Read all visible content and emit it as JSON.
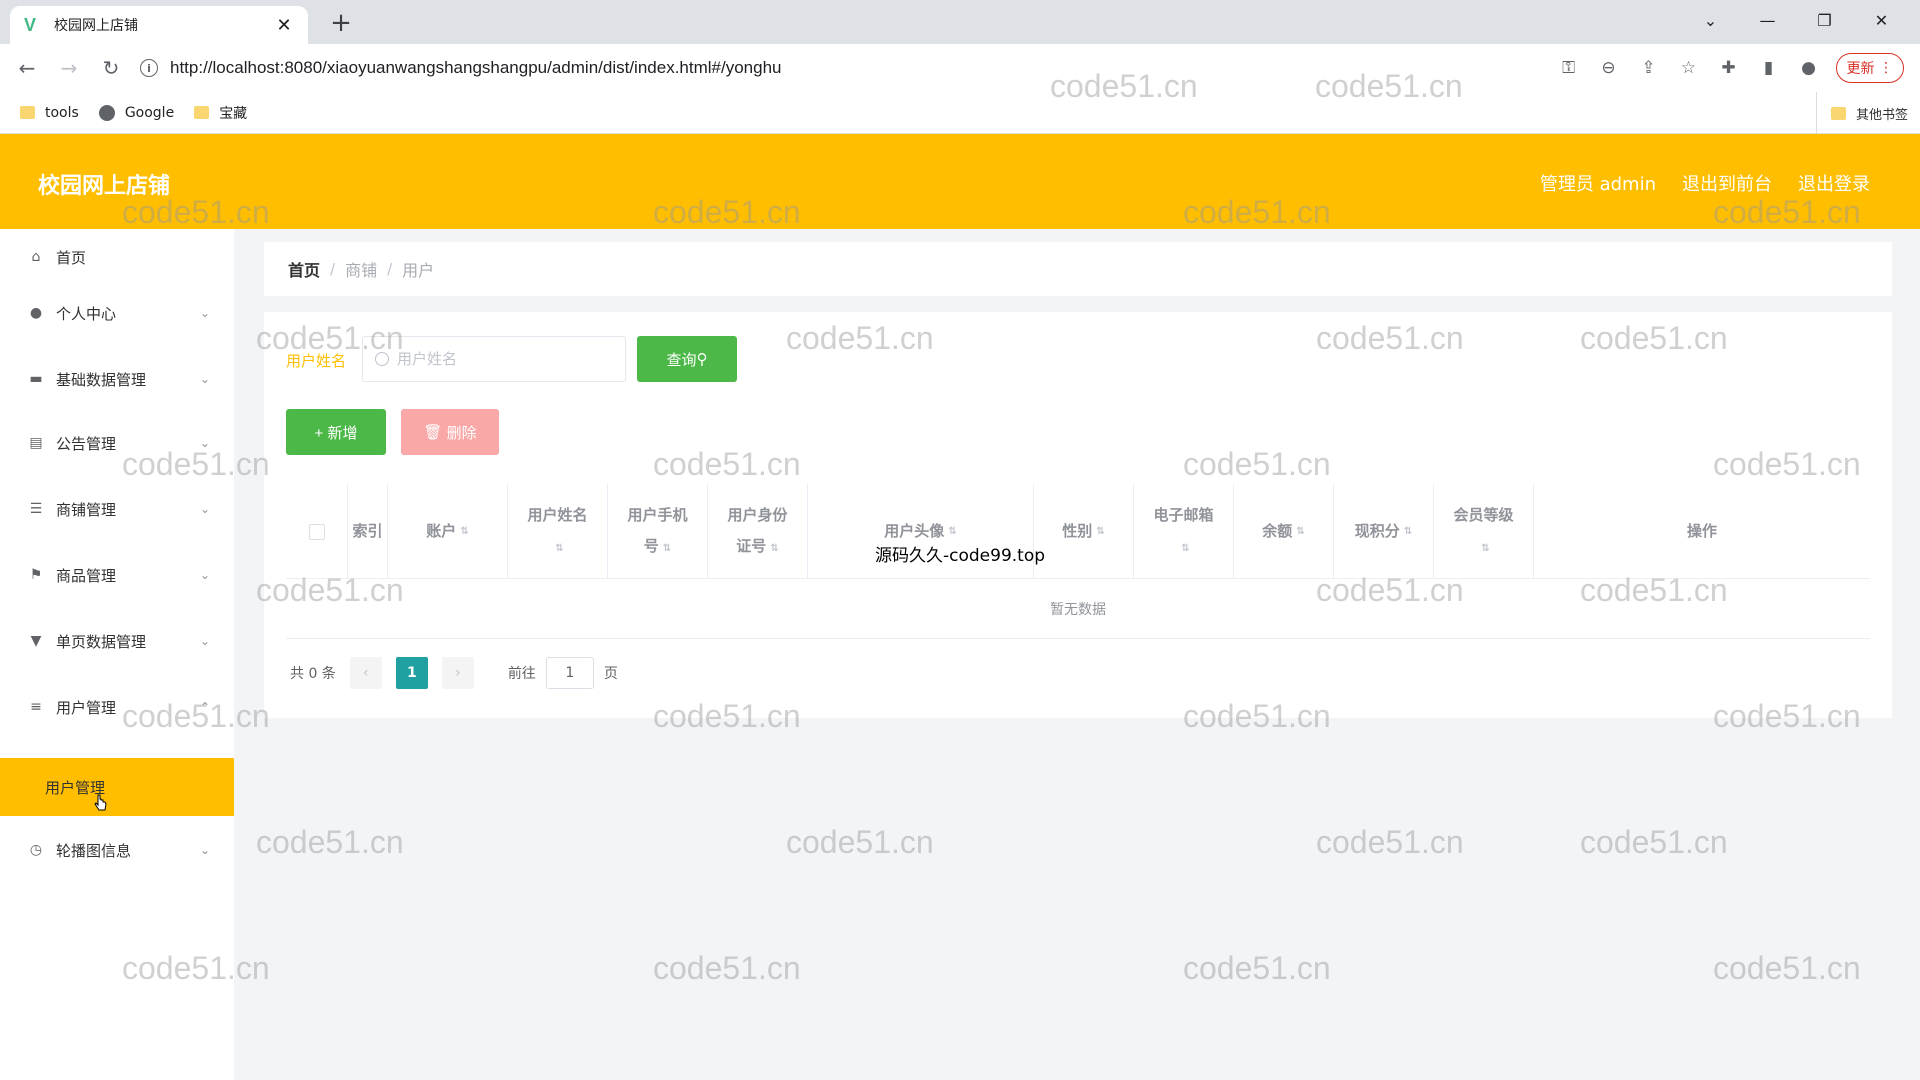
{
  "browser": {
    "tab_title": "校园网上店铺",
    "tab_close": "✕",
    "new_tab": "+",
    "url": "http://localhost:8080/xiaoyuanwangshangshangpu/admin/dist/index.html#/yonghu",
    "update_label": "更新",
    "bookmarks": [
      {
        "label": "tools",
        "icon": "folder-icon"
      },
      {
        "label": "Google",
        "icon": "globe-icon"
      },
      {
        "label": "宝藏",
        "icon": "folder-icon"
      }
    ],
    "other_bookmarks": "其他书签"
  },
  "header": {
    "brand": "校园网上店铺",
    "admin_label": "管理员 admin",
    "back_to_front": "退出到前台",
    "logout": "退出登录"
  },
  "sidebar": {
    "items": [
      {
        "label": "首页",
        "icon": "home-icon",
        "chevron": false
      },
      {
        "label": "个人中心",
        "icon": "user-icon",
        "chevron": true
      },
      {
        "label": "基础数据管理",
        "icon": "briefcase-icon",
        "chevron": true
      },
      {
        "label": "公告管理",
        "icon": "clipboard-icon",
        "chevron": true
      },
      {
        "label": "商铺管理",
        "icon": "sliders-icon",
        "chevron": true
      },
      {
        "label": "商品管理",
        "icon": "flag-icon",
        "chevron": true
      },
      {
        "label": "单页数据管理",
        "icon": "pin-icon",
        "chevron": true
      },
      {
        "label": "用户管理",
        "icon": "menu-icon",
        "chevron": true
      },
      {
        "label": "轮播图信息",
        "icon": "clock-icon",
        "chevron": true
      }
    ],
    "active_sub": "用户管理"
  },
  "breadcrumb": [
    "首页",
    "商铺",
    "用户"
  ],
  "search": {
    "label": "用户姓名",
    "placeholder": "用户姓名",
    "query_button": "查询 ",
    "add_button": "+ 新增",
    "delete_button": "删除"
  },
  "table": {
    "columns": [
      "索引",
      "账户",
      "用户姓名",
      "用户手机号",
      "用户身份证号",
      "用户头像",
      "性别",
      "电子邮箱",
      "余额",
      "现积分",
      "会员等级",
      "操作"
    ],
    "empty_text": "暂无数据",
    "overlay_text": "源码久久-code99.top"
  },
  "pagination": {
    "total": "共 0 条",
    "current_page": "1",
    "goto_prefix": "前往",
    "goto_value": "1",
    "goto_suffix": "页"
  },
  "watermark": "code51.cn",
  "colors": {
    "accent": "#ffbf00",
    "success": "#4cb848",
    "danger_light": "#f9a7a7",
    "page_active": "#20a0a0"
  }
}
